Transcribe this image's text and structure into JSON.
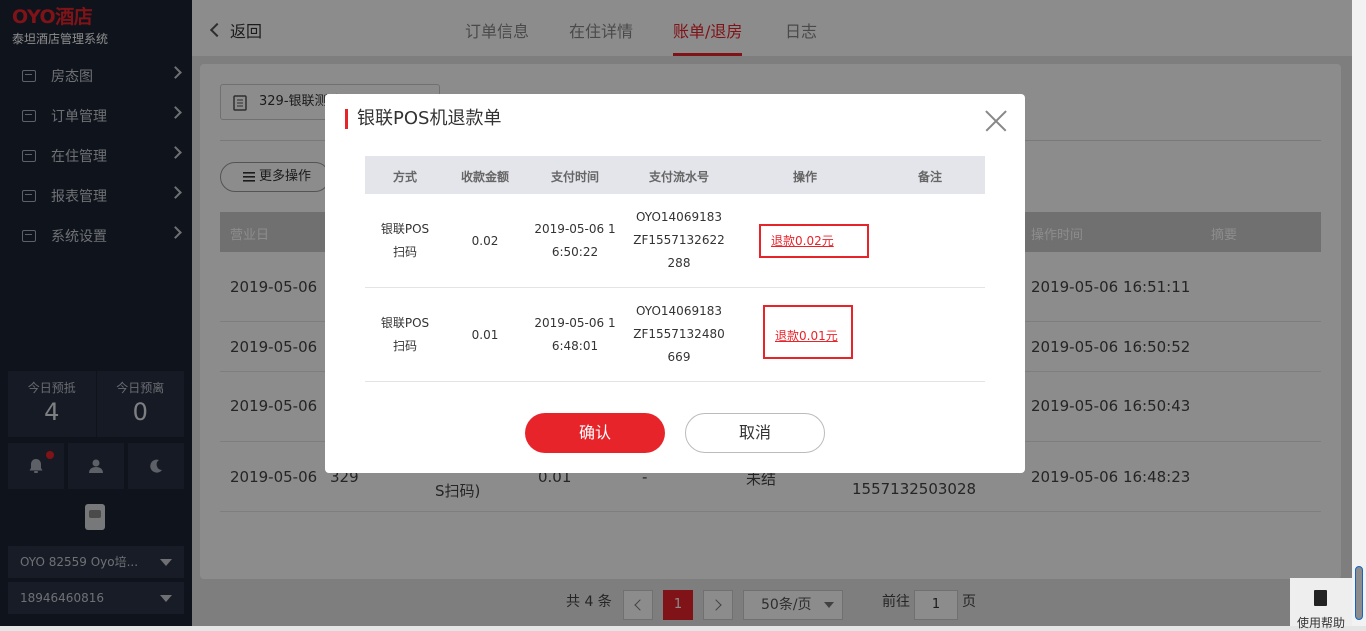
{
  "sidebar": {
    "logo": "OYO酒店",
    "system_name": "泰坦酒店管理系统",
    "menu": [
      {
        "label": "房态图"
      },
      {
        "label": "订单管理"
      },
      {
        "label": "在住管理"
      },
      {
        "label": "报表管理"
      },
      {
        "label": "系统设置"
      }
    ],
    "stats": {
      "arrive_label": "今日预抵",
      "arrive_count": "4",
      "depart_label": "今日预离",
      "depart_count": "0"
    },
    "hotel_select": "OYO 82559 Oyo培...",
    "phone_select": "18946460816"
  },
  "topbar": {
    "back_label": "返回",
    "tabs": [
      "订单信息",
      "在住详情",
      "账单/退房",
      "日志"
    ],
    "active_tab": "账单/退房"
  },
  "content": {
    "room_select": "329-银联测试",
    "more_ops": "更多操作",
    "table_headers": {
      "business_day": "营业日",
      "op_time": "操作时间",
      "summary": "摘要"
    },
    "rows": [
      {
        "day": "2019-05-06",
        "time": "2019-05-06 16:51:11"
      },
      {
        "day": "2019-05-06",
        "time": "2019-05-06 16:50:52"
      },
      {
        "day": "2019-05-06",
        "time": "2019-05-06 16:50:43"
      },
      {
        "day": "2019-05-06",
        "room": "329",
        "method": "S扫码)",
        "amount": "0.01",
        "dash": "-",
        "status": "未结",
        "serial": "1557132503028",
        "time": "2019-05-06 16:48:23"
      }
    ],
    "pager": {
      "total": "共 4 条",
      "page": "1",
      "page_size": "50条/页",
      "goto_label": "前往",
      "goto_value": "1",
      "page_suffix": "页"
    }
  },
  "help_label": "使用帮助",
  "modal": {
    "title": "银联POS机退款单",
    "headers": [
      "方式",
      "收款金额",
      "支付时间",
      "支付流水号",
      "操作",
      "备注"
    ],
    "rows": [
      {
        "method1": "银联POS",
        "method2": "扫码",
        "amount": "0.02",
        "time1": "2019-05-06 1",
        "time2": "6:50:22",
        "serial1": "OYO14069183",
        "serial2": "ZF1557132622",
        "serial3": "288",
        "refund": "退款0.02元"
      },
      {
        "method1": "银联POS",
        "method2": "扫码",
        "amount": "0.01",
        "time1": "2019-05-06 1",
        "time2": "6:48:01",
        "serial1": "OYO14069183",
        "serial2": "ZF1557132480",
        "serial3": "669",
        "refund": "退款0.01元"
      }
    ],
    "confirm": "确认",
    "cancel": "取消"
  },
  "colors": {
    "accent": "#e8242b",
    "sidebar_bg": "#1c2434"
  }
}
